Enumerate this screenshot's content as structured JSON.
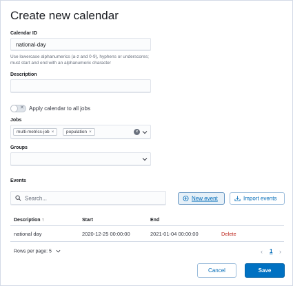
{
  "page": {
    "title": "Create new calendar"
  },
  "calendar_id": {
    "label": "Calendar ID",
    "value": "national-day",
    "help": "Use lowercase alphanumerics (a-z and 0-9), hyphens or underscores; must start and end with an alphanumeric character"
  },
  "description": {
    "label": "Description",
    "value": ""
  },
  "apply_all": {
    "label": "Apply calendar to all jobs",
    "checked": false
  },
  "jobs": {
    "label": "Jobs",
    "selected": [
      "multi-metrics-job",
      "population"
    ],
    "remove_glyph": "×",
    "clear_glyph": "×"
  },
  "groups": {
    "label": "Groups",
    "selected": []
  },
  "events": {
    "label": "Events",
    "search_placeholder": "Search...",
    "new_event_label": "New event",
    "import_events_label": "Import events",
    "columns": [
      "Description",
      "Start",
      "End"
    ],
    "sort_indicator": "↑",
    "rows": [
      {
        "description": "national day",
        "start": "2020-12-25 00:00:00",
        "end": "2021-01-04 00:00:00",
        "action": "Delete"
      }
    ],
    "rows_per_page": "Rows per page: 5",
    "current_page": "1"
  },
  "footer": {
    "cancel_label": "Cancel",
    "save_label": "Save"
  },
  "colors": {
    "primary": "#0071c2",
    "link": "#006bb8",
    "danger": "#bd271e",
    "border": "#d3dae6"
  }
}
